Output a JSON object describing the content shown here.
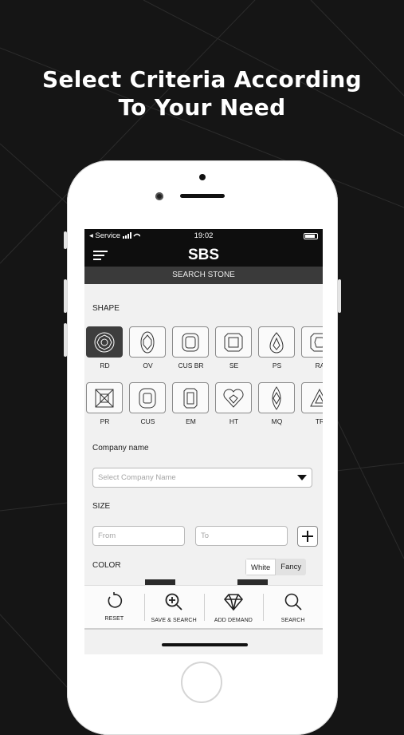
{
  "headline": {
    "line1": "Select Criteria According",
    "line2": "To Your Need"
  },
  "status_bar": {
    "carrier": "◂ Service",
    "time": "19:02"
  },
  "app": {
    "title": "SBS",
    "subtitle": "SEARCH STONE"
  },
  "shape": {
    "label": "SHAPE",
    "row1": [
      {
        "code": "RD",
        "icon": "round-diamond-icon",
        "selected": true
      },
      {
        "code": "OV",
        "icon": "oval-icon"
      },
      {
        "code": "CUS BR",
        "icon": "cushion-brilliant-icon"
      },
      {
        "code": "SE",
        "icon": "square-emerald-icon"
      },
      {
        "code": "PS",
        "icon": "pear-icon"
      },
      {
        "code": "RA",
        "icon": "radiant-icon"
      }
    ],
    "row2": [
      {
        "code": "PR",
        "icon": "princess-icon"
      },
      {
        "code": "CUS",
        "icon": "cushion-icon"
      },
      {
        "code": "EM",
        "icon": "emerald-icon"
      },
      {
        "code": "HT",
        "icon": "heart-icon"
      },
      {
        "code": "MQ",
        "icon": "marquise-icon"
      },
      {
        "code": "TR",
        "icon": "trilliant-icon"
      }
    ]
  },
  "company": {
    "label": "Company name",
    "placeholder": "Select Company Name"
  },
  "size": {
    "label": "SIZE",
    "from_placeholder": "From",
    "to_placeholder": "To"
  },
  "color": {
    "label": "COLOR",
    "options": [
      "White",
      "Fancy"
    ],
    "selected": "White"
  },
  "bottom_nav": [
    {
      "label": "RESET",
      "icon": "reset-icon"
    },
    {
      "label": "SAVE & SEARCH",
      "icon": "zoom-plus-icon"
    },
    {
      "label": "ADD DEMAND",
      "icon": "diamond-icon"
    },
    {
      "label": "SEARCH",
      "icon": "search-icon"
    }
  ]
}
